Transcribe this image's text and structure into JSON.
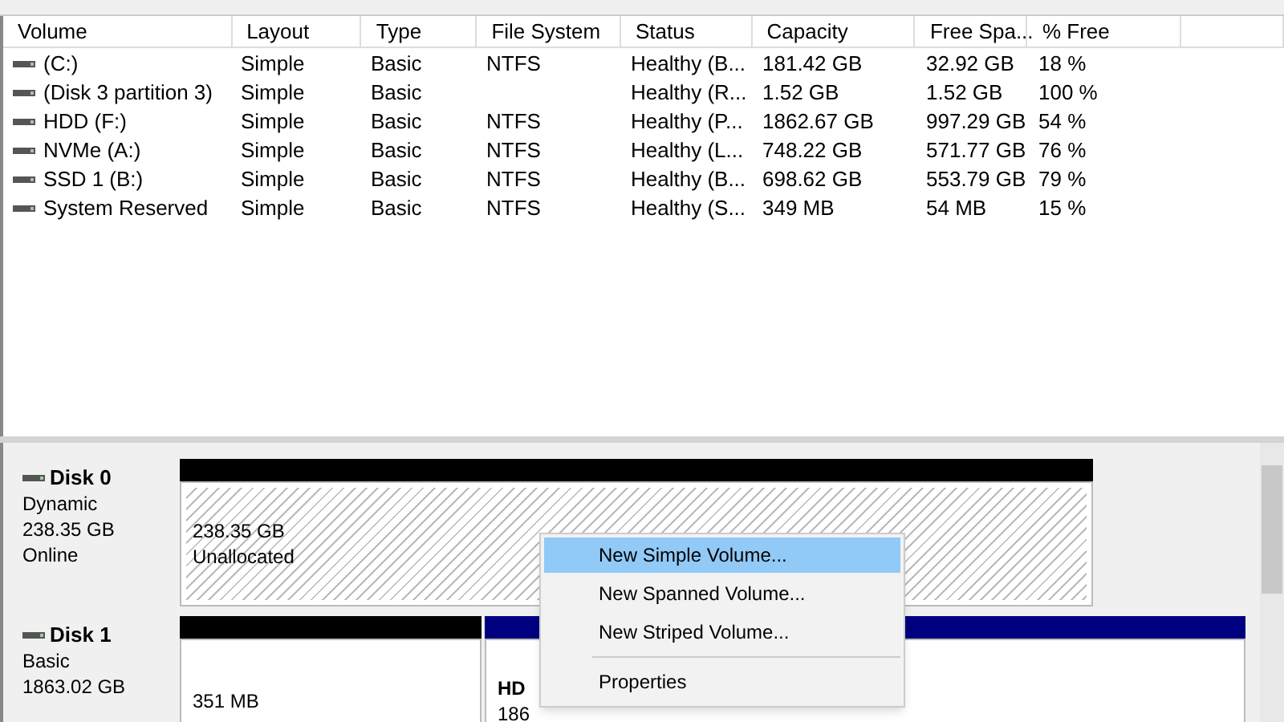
{
  "table": {
    "columns": [
      "Volume",
      "Layout",
      "Type",
      "File System",
      "Status",
      "Capacity",
      "Free Spa...",
      "% Free"
    ],
    "rows": [
      {
        "cells": [
          " (C:)",
          "Simple",
          "Basic",
          "NTFS",
          "Healthy (B...",
          "181.42 GB",
          "32.92 GB",
          "18 %"
        ]
      },
      {
        "cells": [
          "(Disk 3 partition 3)",
          "Simple",
          "Basic",
          "",
          "Healthy (R...",
          "1.52 GB",
          "1.52 GB",
          "100 %"
        ]
      },
      {
        "cells": [
          "HDD (F:)",
          "Simple",
          "Basic",
          "NTFS",
          "Healthy (P...",
          "1862.67 GB",
          "997.29 GB",
          "54 %"
        ]
      },
      {
        "cells": [
          "NVMe (A:)",
          "Simple",
          "Basic",
          "NTFS",
          "Healthy (L...",
          "748.22 GB",
          "571.77 GB",
          "76 %"
        ]
      },
      {
        "cells": [
          "SSD 1 (B:)",
          "Simple",
          "Basic",
          "NTFS",
          "Healthy (B...",
          "698.62 GB",
          "553.79 GB",
          "79 %"
        ]
      },
      {
        "cells": [
          "System Reserved",
          "Simple",
          "Basic",
          "NTFS",
          "Healthy (S...",
          "349 MB",
          "54 MB",
          "15 %"
        ]
      }
    ]
  },
  "disks": [
    {
      "name": "Disk 0",
      "type": "Dynamic",
      "size": "238.35 GB",
      "status": "Online",
      "partitions": [
        {
          "kind": "unallocated",
          "lines": [
            "238.35 GB",
            "Unallocated"
          ]
        }
      ]
    },
    {
      "name": "Disk 1",
      "type": "Basic",
      "size": "1863.02 GB",
      "partitions": [
        {
          "kind": "primary",
          "lines": [
            "351 MB"
          ]
        },
        {
          "kind": "primary",
          "title": "HD",
          "lines": [
            "186"
          ]
        }
      ]
    }
  ],
  "context_menu": {
    "items": [
      {
        "label": "New Simple Volume...",
        "selected": true
      },
      {
        "label": "New Spanned Volume...",
        "selected": false
      },
      {
        "label": "New Striped Volume...",
        "selected": false
      },
      {
        "kind": "separator"
      },
      {
        "label": "Properties",
        "selected": false
      }
    ]
  }
}
